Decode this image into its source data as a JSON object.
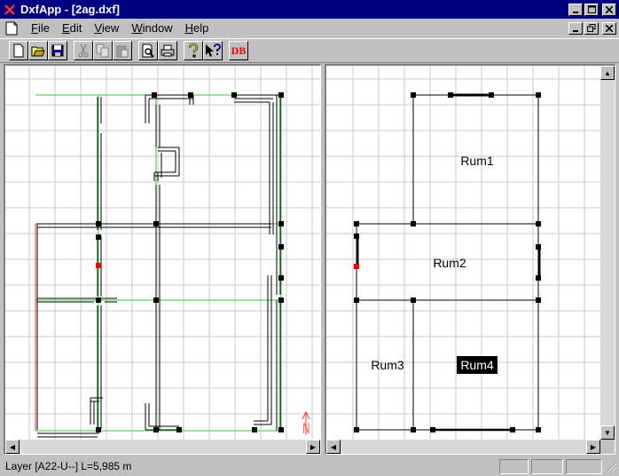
{
  "window": {
    "title": "DxfApp - [2ag.dxf]"
  },
  "menu": [
    {
      "label": "File",
      "accel": "F",
      "rest": "ile"
    },
    {
      "label": "Edit",
      "accel": "E",
      "rest": "dit"
    },
    {
      "label": "View",
      "accel": "V",
      "rest": "iew"
    },
    {
      "label": "Window",
      "accel": "W",
      "rest": "indow"
    },
    {
      "label": "Help",
      "accel": "H",
      "rest": "elp"
    }
  ],
  "toolbar": {
    "buttons": [
      "new-file",
      "open-folder",
      "save",
      "cut",
      "copy",
      "paste",
      "print-preview",
      "print",
      "help",
      "context-help",
      "database"
    ],
    "db_label": "DB"
  },
  "north_label": "N",
  "rooms": [
    {
      "name": "Rum1",
      "selected": false
    },
    {
      "name": "Rum2",
      "selected": false
    },
    {
      "name": "Rum3",
      "selected": false
    },
    {
      "name": "Rum4",
      "selected": true
    }
  ],
  "status": {
    "text": "Layer [A22-U--] L=5,985 m"
  },
  "colors": {
    "titlebar": "#000080",
    "grid": "#c8c8c8",
    "room_edge": "#33cc33",
    "selection": "#ff0000",
    "wall": "#000000"
  }
}
